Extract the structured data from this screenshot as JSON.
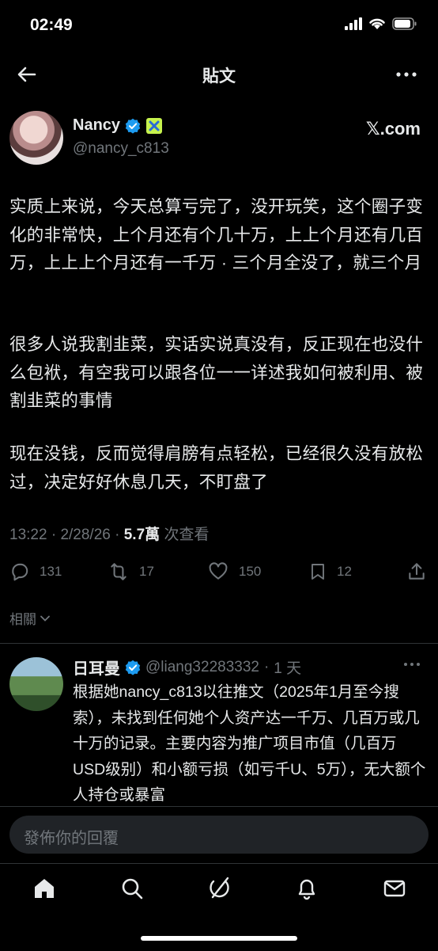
{
  "status_bar": {
    "time": "02:49"
  },
  "header": {
    "title": "貼文"
  },
  "post": {
    "author_name": "Nancy",
    "author_handle": "@nancy_c813",
    "source_logo_text": "𝕏.com",
    "paragraphs": [
      "实质上来说，今天总算亏完了，没开玩笑，这个圈子变化的非常快，上个月还有个几十万，上上个月还有几百万，上上上个月还有一千万 · 三个月全没了，就三个月",
      "很多人说我割韭菜，实话实说真没有，反正现在也没什么包袱，有空我可以跟各位一一详述我如何被利用、被割韭菜的事情",
      "现在没钱，反而觉得肩膀有点轻松，已经很久没有放松过，决定好好休息几天，不盯盘了"
    ],
    "time": "13:22",
    "date": "2/28/26",
    "views_count": "5.7萬",
    "views_label": "次查看",
    "replies": "131",
    "reposts": "17",
    "likes": "150",
    "bookmarks": "12",
    "related_label": "相關"
  },
  "reply": {
    "name": "日耳曼",
    "handle": "@liang32283332",
    "age": "1 天",
    "text": "根据她nancy_c813以往推文（2025年1月至今搜索），未找到任何她个人资产达一千万、几百万或几十万的记录。主要内容为推广项目市值（几百万USD级别）和小额亏损（如亏千U、5万），无大额个人持仓或暴富"
  },
  "composer": {
    "placeholder": "發佈你的回覆"
  },
  "colors": {
    "verified": "#1d9bf0",
    "affiliate": "#c6f24e",
    "muted": "#71767b"
  }
}
